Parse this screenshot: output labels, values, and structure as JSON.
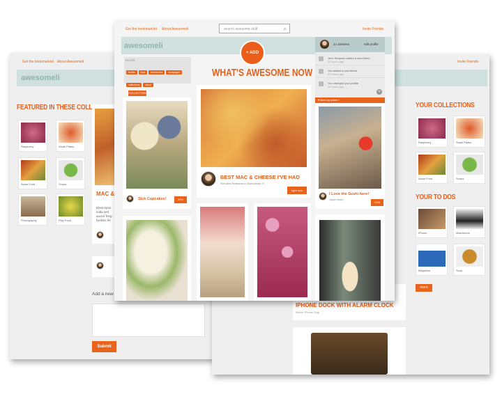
{
  "left_page": {
    "nav": [
      "Get the bookmarklet",
      "About Awesomeli"
    ],
    "brand": "awesomeli",
    "featured_title": "FEATURED IN THESE COLLECTIONS",
    "tiles": [
      "Raspberry",
      "Small Plates",
      "Asian Food",
      "Soups",
      "Photography",
      "Play Food"
    ],
    "detail_title": "MAC & C",
    "detail_text": [
      "IDescriptio",
      "nulla sed",
      "auctor fring",
      "facilisis fel"
    ],
    "add_comment": "Add a new c",
    "submit": "Submit"
  },
  "right_page": {
    "invite": "Invite Friends",
    "your_collections": "YOUR COLLECTIONS",
    "collections": [
      "Raspberry",
      "Small Plates",
      "Asian Food",
      "Soups"
    ],
    "todos_title": "YOUR TO DOS",
    "todos": [
      "iPhone",
      "Matchbook",
      "Magazine",
      "Soup"
    ],
    "more": "more",
    "card_title": "IPHONE DOCK WITH ALARM CLOCK",
    "card_sub": "Newer iPhone Sygi"
  },
  "main_page": {
    "nav": [
      "Get the bookmarklet",
      "About Awesomeli"
    ],
    "search_placeholder": "search awesome stuff",
    "invite": "Invite Friends",
    "brand": "awesomeli",
    "add": "+ ADD",
    "heading": "WHAT'S AWESOME NOW",
    "filter_label": "FILTER",
    "filters": [
      "foodie",
      "food",
      "electronics",
      "newspaper",
      "collections",
      "decor"
    ],
    "user": "Jo Jansiera",
    "edit_profile": "edit profile",
    "activity": [
      {
        "text": "Jenn Simpson added a new friend",
        "time": "20 hours ago"
      },
      {
        "text": "You added a new friend",
        "time": "20 hours ago"
      },
      {
        "text": "You changed your profile",
        "time": "20 hours ago"
      }
    ],
    "collection_btn": "COLLECTION",
    "liked_by": "liked by adam f",
    "feature_title": "BEST MAC & CHEESE I'VE HAD",
    "feature_sub": "Pancakes Restaurant in Miami Beach, Fl",
    "right_now": "right now",
    "cupcakes": "Sick Cupcakes!",
    "cupcakes_count": "2/16",
    "sushi": "I Love the Sushi here!",
    "sushi_sub": "Japan Heavy",
    "sushi_count": "2/15"
  }
}
